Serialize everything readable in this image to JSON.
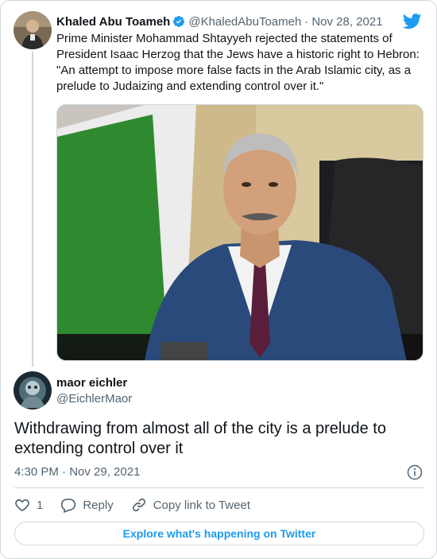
{
  "quoted_tweet": {
    "author_name": "Khaled Abu Toameh",
    "handle": "@KhaledAbuToameh",
    "separator": "·",
    "date": "Nov 28, 2021",
    "text_lines": [
      "Prime Minister Mohammad Shtayyeh rejected the statements of",
      "President Isaac Herzog that the Jews have a historic right to Hebron:",
      "\"An attempt to impose more false facts in the Arab Islamic city, as a",
      "prelude to Judaizing and extending control over it.\""
    ]
  },
  "reply_tweet": {
    "author_name": "maor eichler",
    "handle": "@EichlerMaor",
    "text_lines": [
      "Withdrawing from almost all of the city is a prelude to",
      "extending control over it"
    ],
    "timestamp": "4:30 PM · Nov 29, 2021"
  },
  "actions": {
    "like_count": "1",
    "reply_label": "Reply",
    "copy_link_label": "Copy link to Tweet"
  },
  "explore_label": "Explore what's happening on Twitter",
  "colors": {
    "brand": "#1d9bf0",
    "text": "#0f1419",
    "secondary": "#536471",
    "border": "#cfd9de"
  },
  "icons": [
    "verified-badge-icon",
    "twitter-bird-icon",
    "info-icon",
    "heart-icon",
    "reply-icon",
    "link-icon"
  ]
}
